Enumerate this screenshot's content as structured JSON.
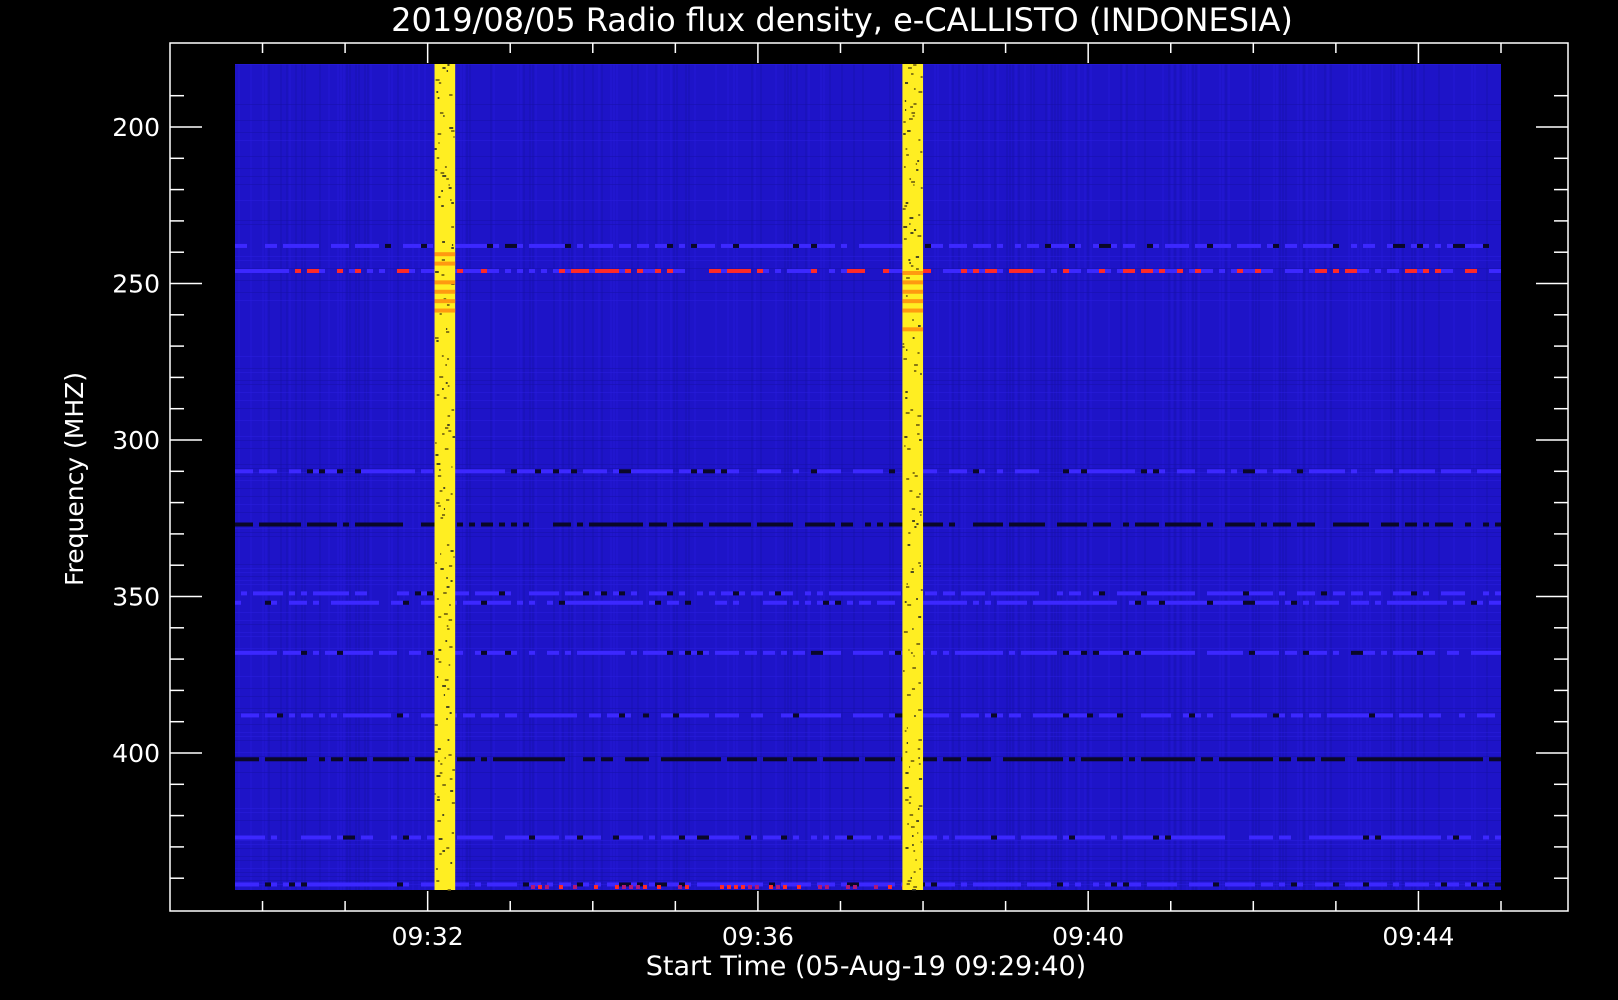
{
  "chart_data": {
    "type": "heatmap",
    "title": "2019/08/05  Radio flux density, e-CALLISTO (INDONESIA)",
    "xlabel": "Start Time (05-Aug-19 09:29:40)",
    "ylabel": "Frequency (MHZ)",
    "x_ticks": [
      "09:32",
      "09:36",
      "09:40",
      "09:44"
    ],
    "y_ticks": [
      "200",
      "250",
      "300",
      "350",
      "400"
    ],
    "x_range": [
      "09:29:40",
      "09:45:00"
    ],
    "y_range_mhz": [
      180,
      445
    ],
    "y_axis_inverted": true,
    "colors": {
      "background": "#000000",
      "foreground": "#ffffff",
      "base": "#1e14c8",
      "base_dark": "#1a12b4",
      "bright": "#3c28ff",
      "dark": "#0a0828",
      "burst": "#ffee22",
      "burst_hot": "#ff9a10",
      "hot": "#ff2a28"
    },
    "bursts": [
      {
        "start": "09:32:05",
        "end": "09:32:20",
        "label": "broadband burst 1"
      },
      {
        "start": "09:37:45",
        "end": "09:38:00",
        "label": "broadband burst 2"
      }
    ],
    "rfi_bands_mhz": [
      {
        "freq": 238,
        "level": "bright"
      },
      {
        "freq": 246,
        "level": "hot"
      },
      {
        "freq": 310,
        "level": "bright"
      },
      {
        "freq": 327,
        "level": "dark"
      },
      {
        "freq": 349,
        "level": "bright"
      },
      {
        "freq": 352,
        "level": "bright"
      },
      {
        "freq": 368,
        "level": "bright"
      },
      {
        "freq": 388,
        "level": "bright"
      },
      {
        "freq": 402,
        "level": "dark"
      },
      {
        "freq": 427,
        "level": "bright"
      },
      {
        "freq": 442,
        "level": "bright"
      }
    ]
  }
}
